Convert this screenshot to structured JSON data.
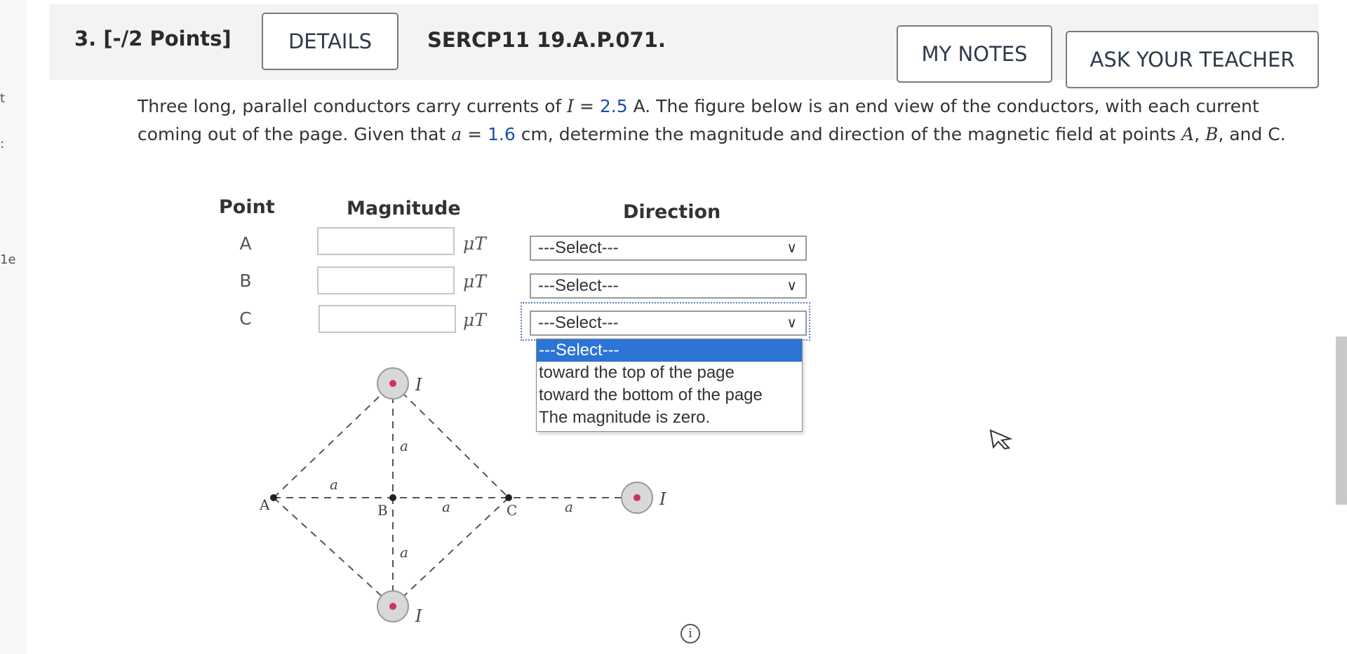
{
  "question": {
    "number_label": "3.",
    "points_label": "[-/2 Points]",
    "details_label": "DETAILS",
    "id_label": "SERCP11 19.A.P.071.",
    "my_notes_label": "MY NOTES",
    "ask_teacher_label": "ASK YOUR TEACHER"
  },
  "left_fragments": [
    "t",
    ":",
    "1e"
  ],
  "problem": {
    "text_1": "Three long, parallel conductors carry currents of ",
    "var_I": "I",
    "eq": " = ",
    "val_I": "2.5",
    "text_2": " A. The figure below is an end view of the conductors, with each current coming out of the page. Given that ",
    "var_a": "a",
    "eq2": " = ",
    "val_a": "1.6",
    "text_3": " cm, determine the magnitude and direction of the magnetic field at points ",
    "pt_A": "A",
    "comma1": ", ",
    "pt_B": "B",
    "text_4": ", and C."
  },
  "table": {
    "point_header": "Point",
    "magnitude_header": "Magnitude",
    "direction_header": "Direction",
    "rows": [
      {
        "point": "A",
        "magnitude": "",
        "unit": "μT",
        "direction": "---Select---"
      },
      {
        "point": "B",
        "magnitude": "",
        "unit": "μT",
        "direction": "---Select---"
      },
      {
        "point": "C",
        "magnitude": "",
        "unit": "μT",
        "direction": "---Select---"
      }
    ]
  },
  "dropdown": {
    "options": [
      "---Select---",
      "toward the top of the page",
      "toward the bottom of the page",
      "The magnitude is zero."
    ],
    "highlighted_index": 0
  },
  "figure": {
    "current_label": "I",
    "spacing_label": "a",
    "point_A": "A",
    "point_B": "B",
    "point_C": "C"
  },
  "info_icon": "info-icon",
  "colors": {
    "value_blue": "#1f4fb0",
    "highlight": "#2c74d6",
    "conductor_dot": "#d0335a"
  }
}
